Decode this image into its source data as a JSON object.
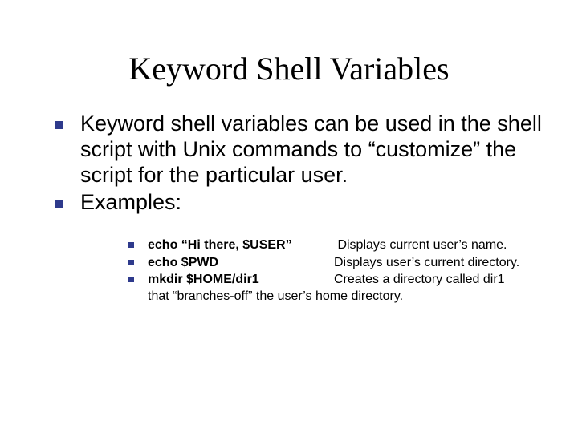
{
  "title": "Keyword Shell Variables",
  "bullets": {
    "b1": "Keyword shell variables can be used in the shell script with Unix commands to “customize” the script for the particular user.",
    "b2": "Examples:"
  },
  "examples": {
    "e1_cmd": "echo  “Hi there, $USER”",
    "e1_desc": " Displays current user’s name.",
    "e2_cmd": "echo $PWD",
    "e2_desc": "Displays user’s current directory.",
    "e3_cmd": "mkdir $HOME/dir1",
    "e3_desc_first": "Creates a directory called dir1",
    "e3_desc_rest": "that “branches-off” the user’s home directory."
  }
}
